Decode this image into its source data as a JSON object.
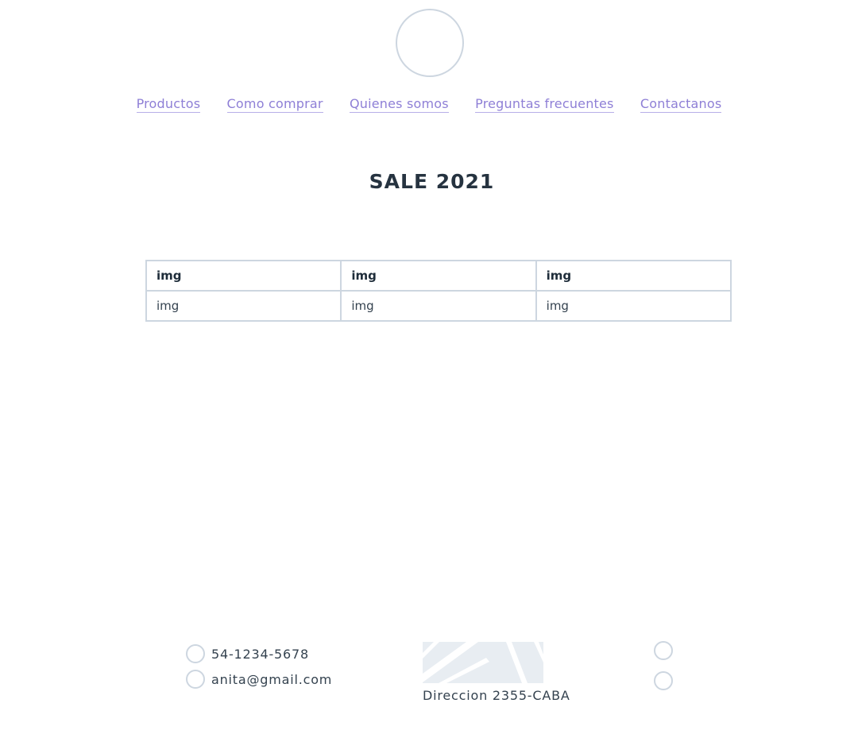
{
  "header": {
    "logo_icon": "circle-logo-icon"
  },
  "nav": {
    "items": [
      {
        "label": "Productos"
      },
      {
        "label": "Como comprar"
      },
      {
        "label": "Quienes somos"
      },
      {
        "label": "Preguntas frecuentes"
      },
      {
        "label": "Contactanos"
      }
    ]
  },
  "main": {
    "title": "SALE 2021",
    "table": {
      "headers": [
        "img",
        "img",
        "img"
      ],
      "rows": [
        [
          "img",
          "img",
          "img"
        ]
      ]
    }
  },
  "footer": {
    "phone": "54-1234-5678",
    "email": "anita@gmail.com",
    "address": "Direccion 2355-CABA",
    "phone_icon": "phone-icon",
    "email_icon": "email-icon",
    "map_icon": "map-icon",
    "social_icons": [
      "social-icon-1",
      "social-icon-2"
    ]
  },
  "colors": {
    "link": "#8e7fd6",
    "text": "#263340",
    "border": "#cdd6e0",
    "map": "#e8edf2"
  }
}
